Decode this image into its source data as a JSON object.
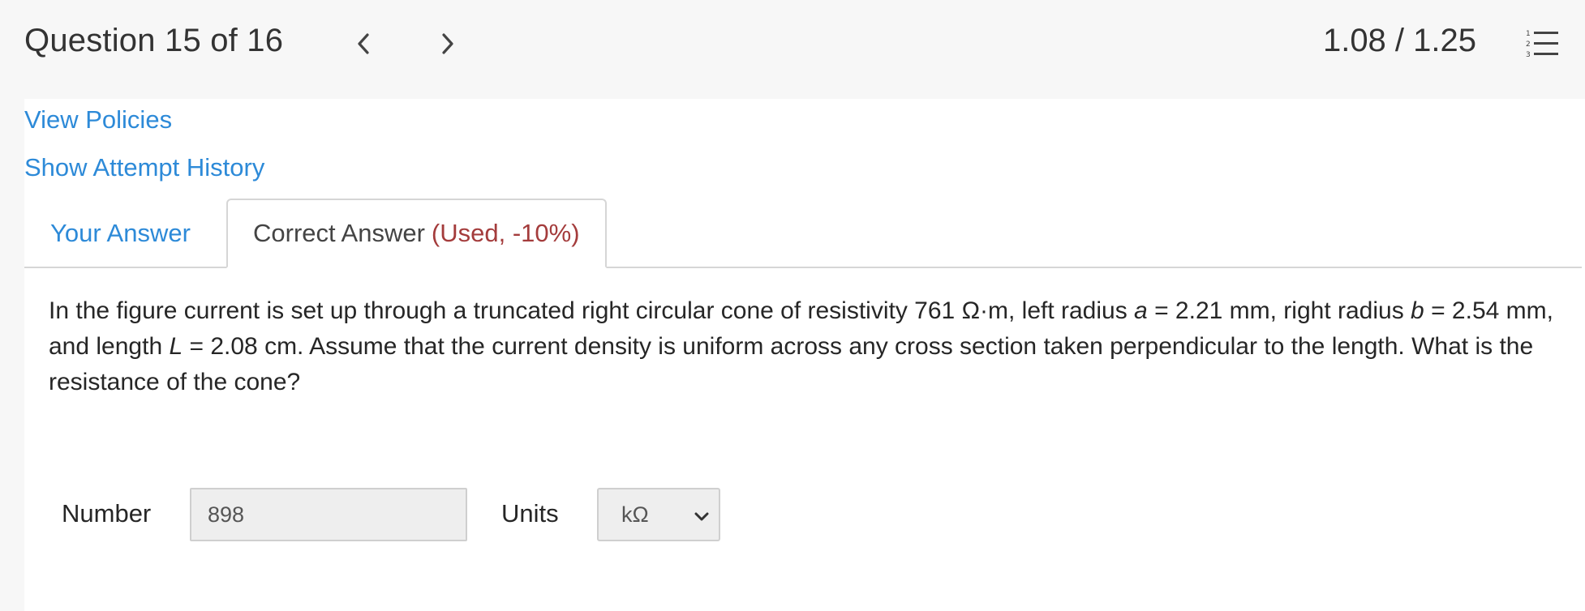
{
  "header": {
    "question_label": "Question 15 of 16",
    "score": "1.08 / 1.25",
    "icons": {
      "prev": "chevron-left-icon",
      "next": "chevron-right-icon",
      "list": "numbered-list-icon"
    }
  },
  "links": {
    "view_policies": "View Policies",
    "attempt_history": "Show Attempt History"
  },
  "tabs": [
    {
      "label": "Your Answer",
      "active": false
    },
    {
      "label": "Correct Answer",
      "note": "(Used, -10%)",
      "active": true
    }
  ],
  "question": {
    "part1": "In the figure current is set up through a truncated right circular cone of resistivity 761 Ω·m, left radius ",
    "var_a": "a",
    "part2": " = 2.21 mm, right radius ",
    "var_b": "b",
    "part3": " = 2.54 mm, and length ",
    "var_L": "L",
    "part4": " = 2.08 cm. Assume that the current density is uniform across any cross section taken perpendicular to the length. What is the resistance of the cone?"
  },
  "answer": {
    "number_label": "Number",
    "number_value": "898",
    "units_label": "Units",
    "units_value": "kΩ"
  },
  "colors": {
    "link": "#2d8ad8",
    "penalty": "#a43c3c",
    "header_bg": "#f7f7f7",
    "panel_bg": "#ffffff"
  }
}
